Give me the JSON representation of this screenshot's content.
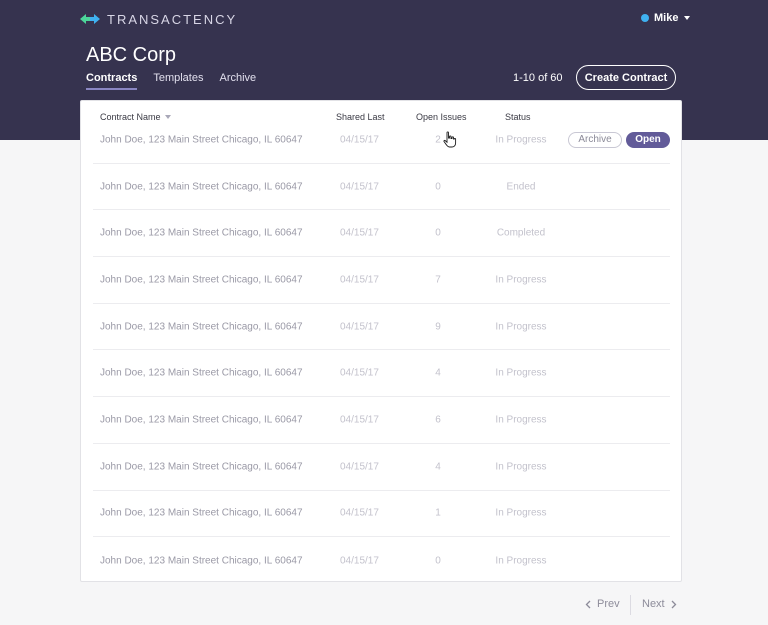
{
  "brand": {
    "name": "TRANSACTENCY",
    "accent": "#3fb1f0",
    "accent2": "#4cd69a"
  },
  "user": {
    "name": "Mike"
  },
  "header": {
    "company": "ABC Corp",
    "tabs": [
      {
        "label": "Contracts",
        "active": true
      },
      {
        "label": "Templates",
        "active": false
      },
      {
        "label": "Archive",
        "active": false
      }
    ],
    "count": "1-10 of 60",
    "create_label": "Create Contract"
  },
  "table": {
    "columns": {
      "name": "Contract Name",
      "shared": "Shared Last",
      "issues": "Open Issues",
      "status": "Status"
    },
    "rows": [
      {
        "name": "John Doe, 123 Main Street Chicago, IL 60647",
        "shared": "04/15/17",
        "issues": "2",
        "status": "In Progress",
        "archive": "Archive",
        "open": "Open"
      },
      {
        "name": "John Doe, 123 Main Street Chicago, IL 60647",
        "shared": "04/15/17",
        "issues": "0",
        "status": "Ended"
      },
      {
        "name": "John Doe, 123 Main Street Chicago, IL 60647",
        "shared": "04/15/17",
        "issues": "0",
        "status": "Completed"
      },
      {
        "name": "John Doe, 123 Main Street Chicago, IL 60647",
        "shared": "04/15/17",
        "issues": "7",
        "status": "In Progress"
      },
      {
        "name": "John Doe, 123 Main Street Chicago, IL 60647",
        "shared": "04/15/17",
        "issues": "9",
        "status": "In Progress"
      },
      {
        "name": "John Doe, 123 Main Street Chicago, IL 60647",
        "shared": "04/15/17",
        "issues": "4",
        "status": "In Progress"
      },
      {
        "name": "John Doe, 123 Main Street Chicago, IL 60647",
        "shared": "04/15/17",
        "issues": "6",
        "status": "In Progress"
      },
      {
        "name": "John Doe, 123 Main Street Chicago, IL 60647",
        "shared": "04/15/17",
        "issues": "4",
        "status": "In Progress"
      },
      {
        "name": "John Doe, 123 Main Street Chicago, IL 60647",
        "shared": "04/15/17",
        "issues": "1",
        "status": "In Progress"
      },
      {
        "name": "John Doe, 123 Main Street Chicago, IL 60647",
        "shared": "04/15/17",
        "issues": "0",
        "status": "In Progress"
      }
    ]
  },
  "pager": {
    "prev": "Prev",
    "next": "Next"
  },
  "icons": {
    "logo": "logo-arrows-icon",
    "status_dot": "online-dot-icon",
    "sort": "sort-caret-icon",
    "cursor": "hand-cursor-icon",
    "prev": "chevron-left-icon",
    "next": "chevron-right-icon"
  }
}
